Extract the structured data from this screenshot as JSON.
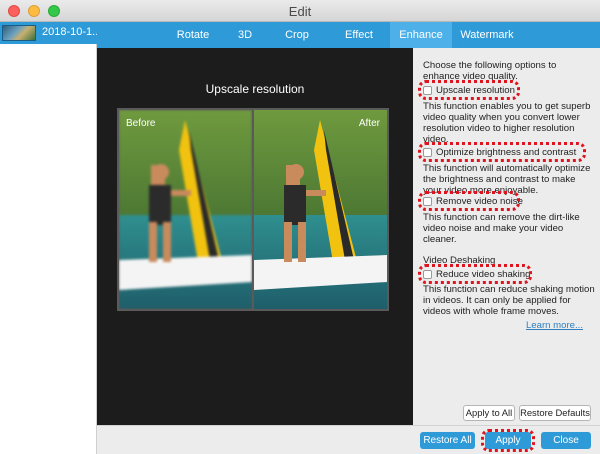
{
  "window": {
    "title": "Edit"
  },
  "sidebar": {
    "items": [
      {
        "name": "2018-10-1..."
      }
    ]
  },
  "tabs": [
    {
      "label": "Rotate"
    },
    {
      "label": "3D"
    },
    {
      "label": "Crop"
    },
    {
      "label": "Effect"
    },
    {
      "label": "Enhance",
      "active": true
    },
    {
      "label": "Watermark"
    }
  ],
  "preview": {
    "title": "Upscale resolution",
    "before_label": "Before",
    "after_label": "After"
  },
  "panel": {
    "intro": "Choose the following options to enhance video quality.",
    "options": [
      {
        "label": "Upscale resolution",
        "checked": false,
        "desc": "This function enables you to get superb video quality when you convert lower resolution video to higher resolution video."
      },
      {
        "label": "Optimize brightness and contrast",
        "checked": false,
        "desc": "This function will automatically optimize the brightness and contrast to make your video more enjoyable."
      },
      {
        "label": "Remove video noise",
        "checked": false,
        "desc": "This function can remove the dirt-like video noise and make your video cleaner."
      }
    ],
    "deshake_section": "Video Deshaking",
    "deshake_option": {
      "label": "Reduce video shaking",
      "checked": false,
      "desc": "This function can reduce shaking motion in videos. It can only be applied for videos with whole frame moves."
    },
    "learn_more": "Learn more...",
    "apply_to_all": "Apply to All",
    "restore_defaults": "Restore Defaults"
  },
  "footer": {
    "restore_all": "Restore All",
    "apply": "Apply",
    "close": "Close"
  },
  "colors": {
    "accent": "#2f9ad8",
    "active_tab": "#4eb0e8",
    "highlight": "#e0141e",
    "link": "#2f7fc1"
  }
}
